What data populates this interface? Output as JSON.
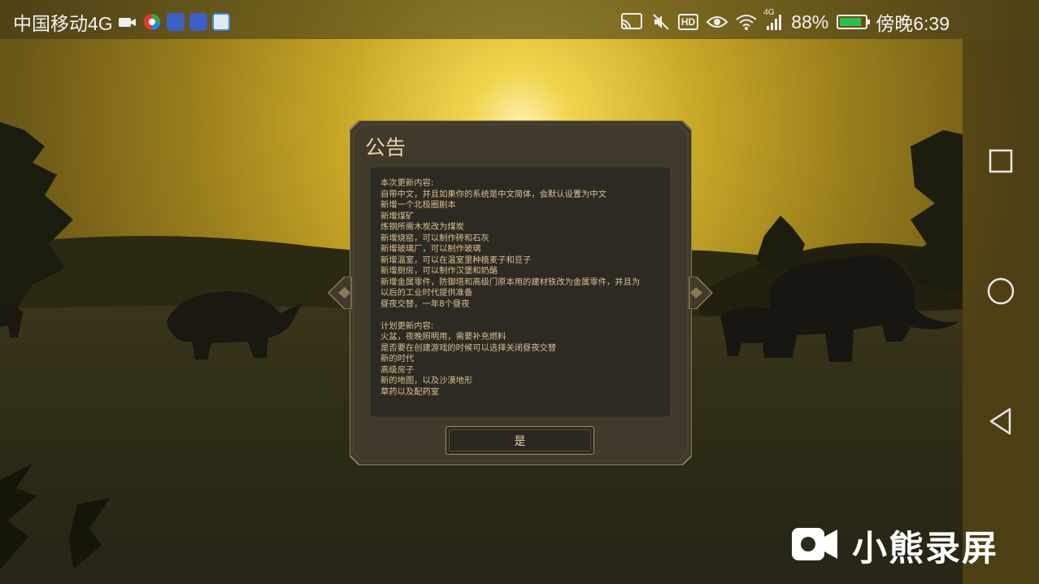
{
  "status_bar": {
    "carrier": "中国移动4G",
    "battery_percent": "88%",
    "battery_level": 0.88,
    "time": "傍晚6:39",
    "network": "4G",
    "icons": [
      "video-camera-icon",
      "app-icon",
      "wifi-hotspot-icon",
      "wifi-hotspot-icon",
      "app-icon",
      "screen-cast-icon",
      "mute-icon",
      "hd-icon",
      "eye-icon",
      "wifi-icon",
      "signal-icon",
      "battery-icon"
    ]
  },
  "dialog": {
    "title": "公告",
    "content_lines": [
      "本次更新内容:",
      "自带中文，并且如果你的系统是中文简体，会默认设置为中文",
      "新增一个北极圈剧本",
      "新增煤矿",
      "炼钢所需木炭改为煤炭",
      "新增烧窑，可以制作砖和石灰",
      "新增玻璃厂，可以制作玻璃",
      "新增温室，可以在温室里种植麦子和豆子",
      "新增厨房，可以制作汉堡和奶酪",
      "新增金属零件，防御塔和高级门原本用的建材铁改为金属零件，并且为",
      "以后的工业时代提供准备",
      "昼夜交替，一年8个昼夜",
      "",
      "计划更新内容:",
      "火盆，夜晚照明用，需要补充燃料",
      "是否要在创建游戏的时候可以选择关闭昼夜交替",
      "新的时代",
      "高级房子",
      "新的地图，以及沙漠地形",
      "草药以及配药室"
    ],
    "confirm_label": "是"
  },
  "watermark": {
    "text": "小熊录屏"
  },
  "colors": {
    "dialog_text": "#d9c092",
    "title_text": "#e8d4aa",
    "dialog_bg": "#3f3a2b",
    "sky_glow": "#f7e27a"
  }
}
